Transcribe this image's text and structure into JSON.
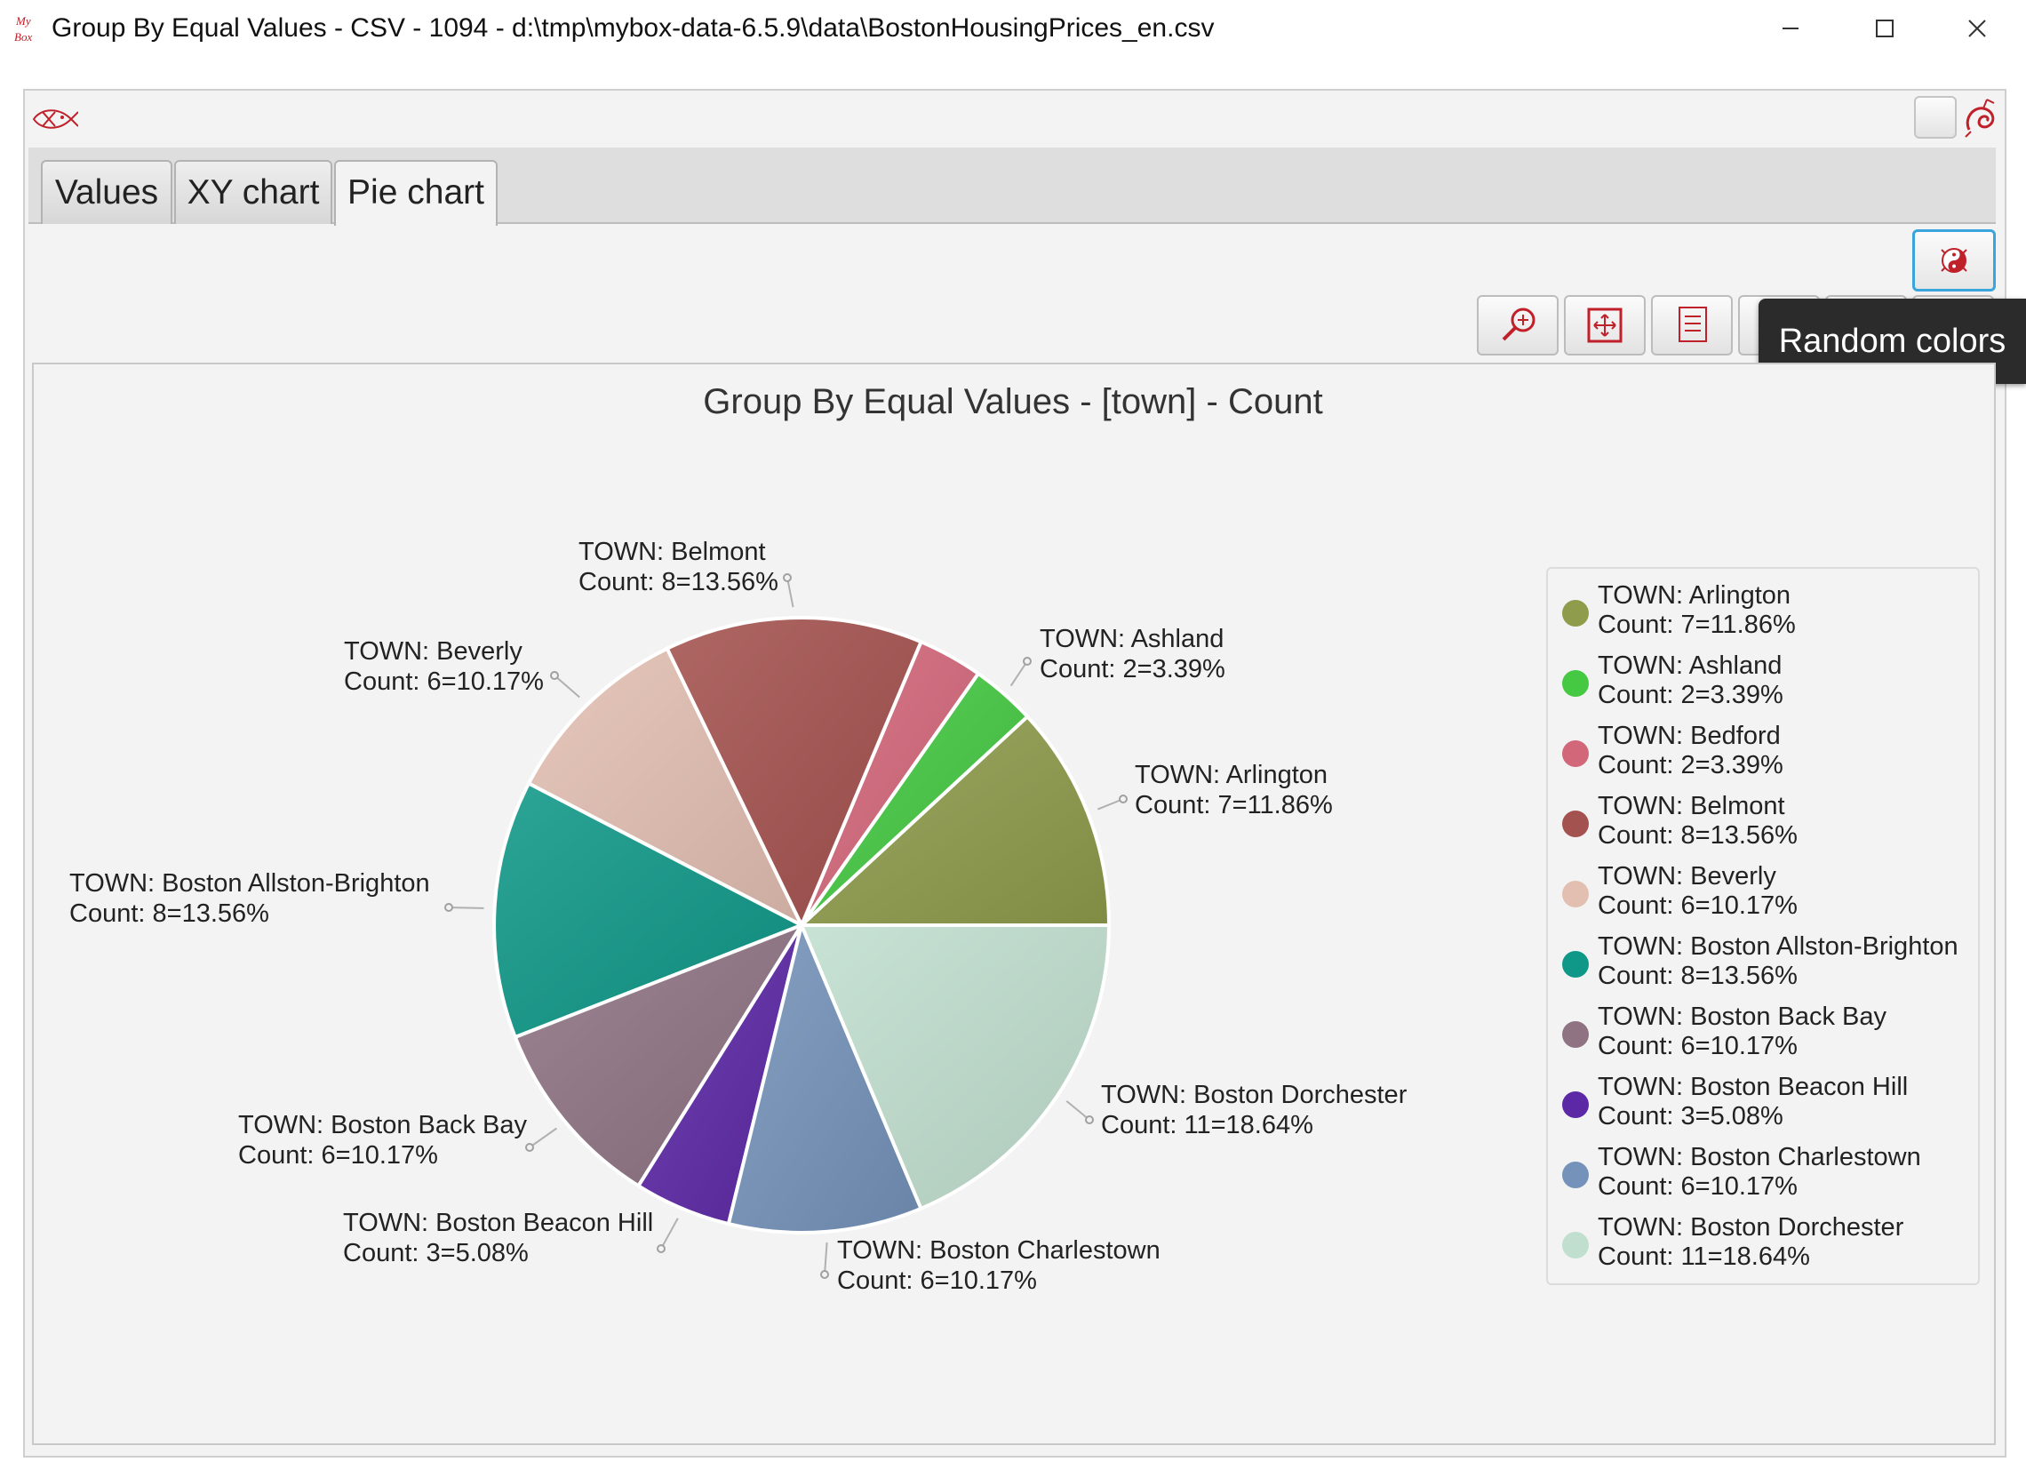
{
  "window": {
    "title": "Group By Equal Values - CSV - 1094 - d:\\tmp\\mybox-data-6.5.9\\data\\BostonHousingPrices_en.csv",
    "logo_text": "My Box",
    "controls": [
      "minimize-icon",
      "maximize-icon",
      "close-icon"
    ]
  },
  "tabs": [
    {
      "label": "Values",
      "selected": false
    },
    {
      "label": "XY chart",
      "selected": false
    },
    {
      "label": "Pie chart",
      "selected": true
    }
  ],
  "toolbar": {
    "random_colors_icon": "yin-yang-icon",
    "buttons": [
      "zoom-in-icon",
      "fit-window-icon",
      "data-list-icon",
      "save-icon",
      "pop-icon",
      "menu-icon"
    ],
    "tooltip": "Random colors"
  },
  "chart_data": {
    "type": "pie",
    "title": "Group By Equal Values - [town] - Count",
    "legend": "right",
    "slices": [
      {
        "name": "TOWN: Arlington",
        "value": 7,
        "percent": "11.86%",
        "label": "Count: 7=11.86%",
        "color": "#8e9c4c"
      },
      {
        "name": "TOWN: Ashland",
        "value": 2,
        "percent": "3.39%",
        "label": "Count: 2=3.39%",
        "color": "#45c943"
      },
      {
        "name": "TOWN: Bedford",
        "value": 2,
        "percent": "3.39%",
        "label": "Count: 2=3.39%",
        "color": "#d3677a"
      },
      {
        "name": "TOWN: Belmont",
        "value": 8,
        "percent": "13.56%",
        "label": "Count: 8=13.56%",
        "color": "#a4524f"
      },
      {
        "name": "TOWN: Beverly",
        "value": 6,
        "percent": "10.17%",
        "label": "Count: 6=10.17%",
        "color": "#e3bfb2"
      },
      {
        "name": "TOWN: Boston Allston-Brighton",
        "value": 8,
        "percent": "13.56%",
        "label": "Count: 8=13.56%",
        "color": "#0f9888"
      },
      {
        "name": "TOWN: Boston Back Bay",
        "value": 6,
        "percent": "10.17%",
        "label": "Count: 6=10.17%",
        "color": "#8f7383"
      },
      {
        "name": "TOWN: Boston Beacon Hill",
        "value": 3,
        "percent": "5.08%",
        "label": "Count: 3=5.08%",
        "color": "#5d28a6"
      },
      {
        "name": "TOWN: Boston Charlestown",
        "value": 6,
        "percent": "10.17%",
        "label": "Count: 6=10.17%",
        "color": "#7593ba"
      },
      {
        "name": "TOWN: Boston Dorchester",
        "value": 11,
        "percent": "18.64%",
        "label": "Count: 11=18.64%",
        "color": "#c1dfcf"
      }
    ]
  }
}
